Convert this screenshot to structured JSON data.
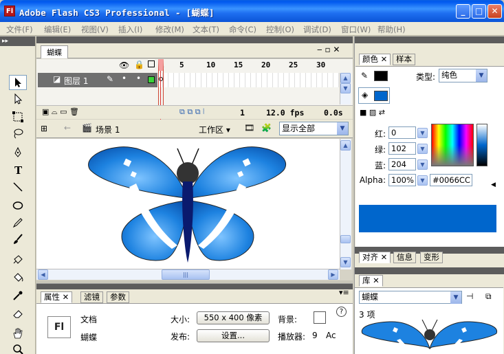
{
  "window": {
    "title": "Adobe Flash CS3 Professional - [蝴蝶]",
    "icon": "Fl",
    "min": "_",
    "max": "□",
    "close": "✕"
  },
  "menu": [
    "文件(F)",
    "编辑(E)",
    "视图(V)",
    "插入(I)",
    "修改(M)",
    "文本(T)",
    "命令(C)",
    "控制(O)",
    "调试(D)",
    "窗口(W)",
    "帮助(H)"
  ],
  "toolbox": {
    "header": "▸▸",
    "tools": [
      "selection-tool",
      "subselection-tool",
      "free-transform-tool",
      "lasso-tool",
      "pen-tool",
      "text-tool",
      "line-tool",
      "oval-tool",
      "pencil-tool",
      "brush-tool",
      "ink-bottle-tool",
      "paint-bucket-tool",
      "eyedropper-tool",
      "eraser-tool",
      "hand-tool",
      "zoom-tool"
    ]
  },
  "document": {
    "tab": "蝴蝶",
    "timeline": {
      "frame_numbers": [
        "1",
        "5",
        "10",
        "15",
        "20",
        "25",
        "30"
      ],
      "layer": "图层 1",
      "current_frame": "1",
      "fps": "12.0 fps",
      "time": "0.0s"
    },
    "edit_bar": {
      "scene": "场景 1",
      "workspace": "工作区 ▾",
      "zoom": "显示全部"
    }
  },
  "properties": {
    "tabs": [
      "属性",
      "滤镜",
      "参数"
    ],
    "doc_icon": "Fl",
    "doc_label": "文档",
    "doc_name": "蝴蝶",
    "size_label": "大小:",
    "size_value": "550 x 400 像素",
    "bg_label": "背景:",
    "publish_label": "发布:",
    "settings_button": "设置...",
    "player_label": "播放器:",
    "player_value": "9",
    "as_value": "Ac",
    "help": "?"
  },
  "color_panel": {
    "tabs": [
      "颜色",
      "样本"
    ],
    "type_label": "类型:",
    "type_value": "纯色",
    "red_label": "红:",
    "red": "0",
    "green_label": "绿:",
    "green": "102",
    "blue_label": "蓝:",
    "blue": "204",
    "alpha_label": "Alpha:",
    "alpha": "100%",
    "hex": "#0066CC",
    "fill_color": "#0066CC",
    "stroke_color": "#000000"
  },
  "align_panel": {
    "tabs": [
      "对齐",
      "信息",
      "变形"
    ]
  },
  "library": {
    "tab": "库",
    "selected": "蝴蝶",
    "count": "3 项"
  }
}
